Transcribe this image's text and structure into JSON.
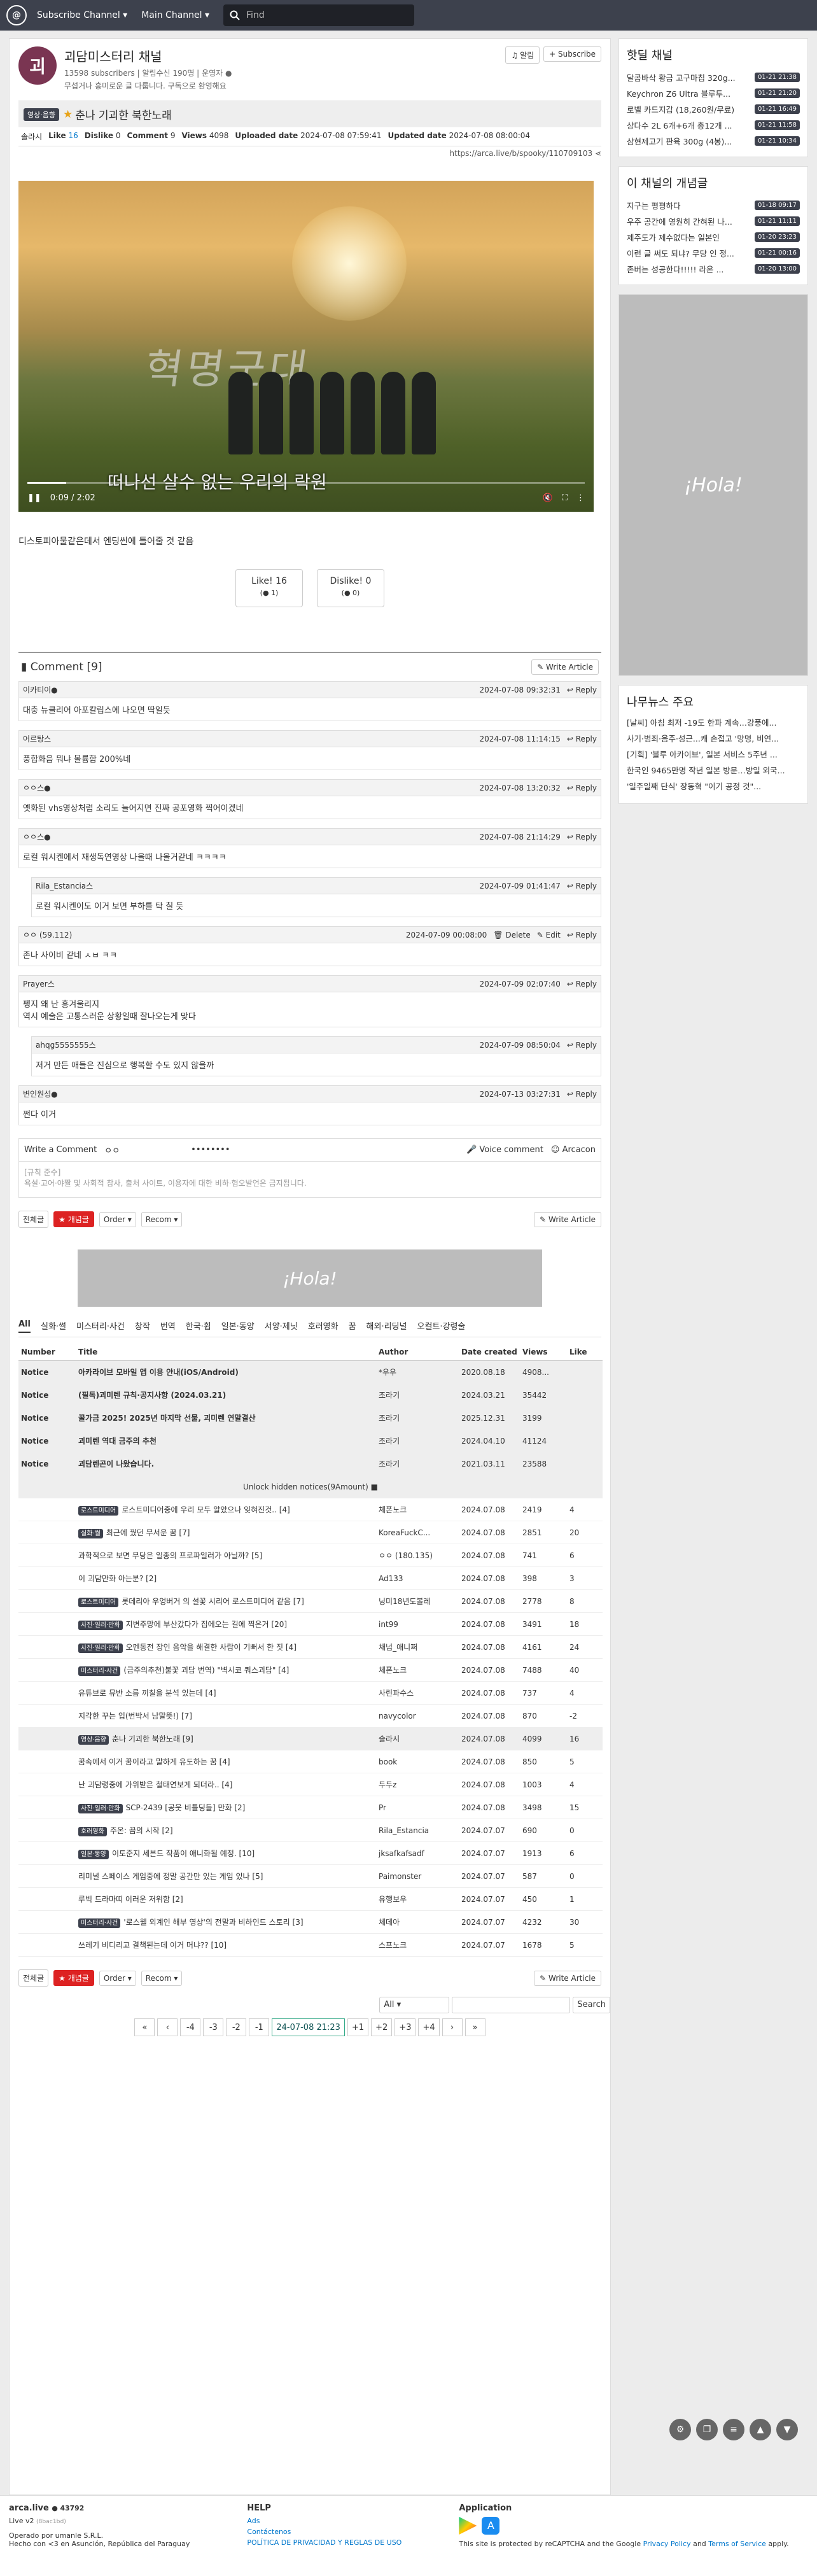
{
  "nav": {
    "subscribe": "Subscribe Channel ▾",
    "main": "Main Channel ▾",
    "search_placeholder": "Find"
  },
  "channel": {
    "icon": "괴",
    "title": "괴담미스터리 채널",
    "subs": "13598 subscribers | 알림수신 190명 | 운영자 ●",
    "desc": "무섭거나 흥미로운 글 다룹니다. 구독으로 환영해요",
    "alarm": "알림",
    "subscribe": "+ Subscribe"
  },
  "article": {
    "category": "영상·음향",
    "title": "춘나 기괴한 북한노래",
    "author": "솔라시",
    "like_l": "Like",
    "like": "16",
    "dislike_l": "Dislike",
    "dislike": "0",
    "comment_l": "Comment",
    "comment": "9",
    "views_l": "Views",
    "views": "4098",
    "up_l": "Uploaded date",
    "uploaded": "2024-07-08 07:59:41",
    "upd_l": "Updated date",
    "updated": "2024-07-08 08:00:04",
    "url": "https://arca.live/b/spooky/110709103",
    "video_text": "혁명군대",
    "video_sub": "떠나선 살수 없는 우리의 락원",
    "time": "0:09 / 2:02",
    "progress": 0.07,
    "desc": "디스토피아물같은데서 엔딩씬에 틀어줄 것 같음",
    "like_btn": "Like! 16",
    "like_sub": "(● 1)",
    "dislike_btn": "Dislike! 0",
    "dislike_sub": "(● 0)"
  },
  "comments_head": "Comment [9]",
  "write_article": "✎ Write Article",
  "reply": "↩ Reply",
  "comments": [
    {
      "user": "이카티이●",
      "date": "2024-07-08 09:32:31",
      "text": "대충 뉴클리어 아포칼립스에 나오면 딱일듯",
      "reply": false
    },
    {
      "user": "어르탕스",
      "date": "2024-07-08 11:14:15",
      "text": "풍합화음 뭐냐 볼륨함 200%네",
      "reply": false
    },
    {
      "user": "ㅇㅇ스●",
      "date": "2024-07-08 13:20:32",
      "text": "옛화된 vhs영상처럼 소리도 늘어지면 진짜 공포영화 찍어이겠네",
      "reply": false
    },
    {
      "user": "ㅇㅇ스●",
      "date": "2024-07-08 21:14:29",
      "text": "로컬 워시켄에서 재생독연영상 나올때 나올거같네 ㅋㅋㅋㅋ",
      "reply": false
    },
    {
      "user": "Rila_Estancia스",
      "date": "2024-07-09 01:41:47",
      "text": "로컬 워시켄이도 이거 보면 부하를 탁 칠 듯",
      "reply": true
    },
    {
      "user": "ㅇㅇ (59.112)",
      "date": "2024-07-09 00:08:00",
      "text": "존나 사이비 같네 ㅅㅂ ㅋㅋ",
      "reply": false,
      "own": true
    },
    {
      "user": "Prayer스",
      "date": "2024-07-09 02:07:40",
      "text": "펭지 왜 난 흥겨울리지\n역시 예술은 고통스러운 상황일때 잘나오는게 맞다",
      "reply": false
    },
    {
      "user": "ahqg5555555스",
      "date": "2024-07-09 08:50:04",
      "text": "저거 만든 애들은 진심으로 행복할 수도 있지 않을까",
      "reply": true
    },
    {
      "user": "변인원성●",
      "date": "2024-07-13 03:27:31",
      "text": "쩐다 이거",
      "reply": false
    }
  ],
  "own_actions": {
    "delete": "🗑 Delete",
    "edit": "✎ Edit"
  },
  "write": {
    "label": "Write a Comment",
    "user": "ㅇㅇ",
    "pw": "••••••••",
    "voice": "Voice comment",
    "arcacon": "Arcacon",
    "rule1": "[규칙 준수]",
    "rule2": "욕설·고어·야짤 및 사회적 참사, 출처 사이트, 이용자에 대한 비하·험오발언은 금지됩니다."
  },
  "listbar": {
    "all": "전체글",
    "hot": "★ 개념글",
    "order": "Order ▾",
    "recom": "Recom ▾"
  },
  "cats": [
    "All",
    "실화·썰",
    "미스터리·사건",
    "창작",
    "번역",
    "한국·휩",
    "일본·동양",
    "서양·제닛",
    "호러영화",
    "꿈",
    "해외·리딩널",
    "오컬트·강령술"
  ],
  "cols": [
    "Number",
    "Title",
    "Author",
    "Date created",
    "Views",
    "Like"
  ],
  "notices": [
    {
      "t": "아카라이브 모바일 앱 이용 안내(iOS/Android)",
      "a": "*우우",
      "d": "2020.08.18",
      "v": "4908..."
    },
    {
      "t": "(필독)괴미렌 규칙·공지사항 (2024.03.21)",
      "a": "조라기",
      "d": "2024.03.21",
      "v": "35442"
    },
    {
      "t": "꿀가금 2025! 2025년 마지막 선물, 괴미렌 연말결산",
      "a": "조라기",
      "d": "2025.12.31",
      "v": "3199"
    },
    {
      "t": "괴미렌 역대 금주의 추천",
      "a": "조라기",
      "d": "2024.04.10",
      "v": "41124"
    },
    {
      "t": "괴담렌곤이 나왔습니다.",
      "a": "조라기",
      "d": "2021.03.11",
      "v": "23588"
    }
  ],
  "unlock": "Unlock hidden notices(9Amount) ■",
  "rows": [
    {
      "c": "로스트미디어",
      "t": "로스트미디어중에 우리 모두 알았으나 잊혀진것.. [4]",
      "a": "체폰노크",
      "d": "2024.07.08",
      "v": "2419",
      "l": "4"
    },
    {
      "c": "실화·썰",
      "t": "최근에 꿨던 무서운 꿈 [7]",
      "a": "KoreaFuckC...",
      "d": "2024.07.08",
      "v": "2851",
      "l": "20"
    },
    {
      "c": "",
      "t": "과학적으로 보면 무당은 일종의 프로파일러가 아닐까? [5]",
      "a": "ㅇㅇ (180.135)",
      "d": "2024.07.08",
      "v": "741",
      "l": "6"
    },
    {
      "c": "",
      "t": "이 괴담만화 아는분? [2]",
      "a": "Ad133",
      "d": "2024.07.08",
      "v": "398",
      "l": "3"
    },
    {
      "c": "로스트미디어",
      "t": "롯데리아 우엉버거 의 설꽃 시리어 로스트미디어 같음 [7]",
      "a": "닝미18년도볼레",
      "d": "2024.07.08",
      "v": "2778",
      "l": "8"
    },
    {
      "c": "사진·일러·만화",
      "t": "지변주망에 부산갔다가 집에오는 길에 찍은거 [20]",
      "a": "int99",
      "d": "2024.07.08",
      "v": "3491",
      "l": "18"
    },
    {
      "c": "사진·일러·만화",
      "t": "오멘동전 장인 음악을 해결한 사람이 기뻐서 한 짓 [4]",
      "a": "채넘_애니쩌",
      "d": "2024.07.08",
      "v": "4161",
      "l": "24"
    },
    {
      "c": "미스터리·사건",
      "t": "(금주의추천)불꽃 괴담 번역) \"벽시코 쿼스괴담\" [4]",
      "a": "체폰노크",
      "d": "2024.07.08",
      "v": "7488",
      "l": "40"
    },
    {
      "c": "",
      "t": "유튜브로 뮤반 소름 끼칠을 분석 있는데 [4]",
      "a": "사린파수스",
      "d": "2024.07.08",
      "v": "737",
      "l": "4"
    },
    {
      "c": "",
      "t": "지각한 꾸는 입(번박서 남말뜻!) [7]",
      "a": "navycolor",
      "d": "2024.07.08",
      "v": "870",
      "l": "-2"
    },
    {
      "c": "영상·음향",
      "t": "춘나 기괴한 북한노래 [9]",
      "a": "솔라시",
      "d": "2024.07.08",
      "v": "4099",
      "l": "16",
      "cur": true
    },
    {
      "c": "",
      "t": "꿈속에서 이거 꿈이라고 말하게 유도하는 꿈 [4]",
      "a": "book",
      "d": "2024.07.08",
      "v": "850",
      "l": "5"
    },
    {
      "c": "",
      "t": "난 괴담령중에 가위받은 철태연보게 되더라.. [4]",
      "a": "두두z",
      "d": "2024.07.08",
      "v": "1003",
      "l": "4"
    },
    {
      "c": "사진·일러·만화",
      "t": "SCP-2439 [공웃 비틀딩들] 만화 [2]",
      "a": "Pr",
      "d": "2024.07.08",
      "v": "3498",
      "l": "15"
    },
    {
      "c": "호러영화",
      "t": "주온: 끔의 시작 [2]",
      "a": "Rila_Estancia",
      "d": "2024.07.07",
      "v": "690",
      "l": "0"
    },
    {
      "c": "일본·동양",
      "t": "이토준지 세븐드 작품이 애니화될 예정. [10]",
      "a": "jksafkafsadf",
      "d": "2024.07.07",
      "v": "1913",
      "l": "6"
    },
    {
      "c": "",
      "t": "리미널 스페이스 게임중에 정말 공간만 있는 게임 있나 [5]",
      "a": "Paimonster",
      "d": "2024.07.07",
      "v": "587",
      "l": "0"
    },
    {
      "c": "",
      "t": "루빅 드라마띠 이러운 저위함 [2]",
      "a": "유행보우",
      "d": "2024.07.07",
      "v": "450",
      "l": "1"
    },
    {
      "c": "미스터리·사건",
      "t": "'로스웰 외계인 해부 영상'의 전말과 비하인드 스토리 [3]",
      "a": "체데아",
      "d": "2024.07.07",
      "v": "4232",
      "l": "30"
    },
    {
      "c": "",
      "t": "쓰레기 비디리고 결책된는데 이거 머냐?? [10]",
      "a": "스프노크",
      "d": "2024.07.07",
      "v": "1678",
      "l": "5"
    }
  ],
  "search": {
    "scope": "All ▾",
    "button": "Search"
  },
  "pages": [
    "«",
    "‹",
    "-4",
    "-3",
    "-2",
    "-1",
    "24-07-08 21:23",
    "+1",
    "+2",
    "+3",
    "+4",
    "›",
    "»"
  ],
  "side": {
    "hot_title": "핫딜 채널",
    "hot": [
      [
        "달콤바삭 황금 고구마칩 320g...",
        "01-21 21:38"
      ],
      [
        "Keychron Z6 Ultra 블루투...",
        "01-21 21:20"
      ],
      [
        "로벨 카드지갑 (18,260원/무료)",
        "01-21 16:49"
      ],
      [
        "상다수 2L 6개+6개 총12개 ...",
        "01-21 11:58"
      ],
      [
        "삼현제고기 판육 300g (4봉)...",
        "01-21 10:34"
      ]
    ],
    "best_title": "이 채널의 개념글",
    "best": [
      [
        "지구는 평평하다",
        "01-18 09:17"
      ],
      [
        "우주 공간에 영원히 간혀된 나...",
        "01-21 11:11"
      ],
      [
        "제주도가 제수없다는 일본인",
        "01-20 23:23"
      ],
      [
        "이런 글 써도 되냐? 무당 인 정...",
        "01-21 00:16"
      ],
      [
        "존버는 성공한다!!!!! 라온 ...",
        "01-20 13:00"
      ]
    ],
    "ad_text": "¡Hola!",
    "news_title": "나무뉴스 주요",
    "news": [
      "[날씨] 아침 최저 -19도 한파 계속…강풍에...",
      "사기·범죄·음주·성근...캐 손접고 '망명, 비연...",
      "[기획] '블루 아카이브', 일본 서비스 5주년 ...",
      "한국인 9465만명 작년 일본 방문…방일 외국...",
      "'일주일째 단식' 장동혁 \"이기 공정 것\"..."
    ]
  },
  "banner_text": "¡Hola!",
  "footer": {
    "brand": "arca.live",
    "users": "● 43792",
    "ver": "Live v2",
    "ver2": "(8bac1bd)",
    "op": "Operado por umanle S.R.L.",
    "made": "Hecho con <3 en Asunción, República del Paraguay",
    "help": "HELP",
    "ads": "Ads",
    "contact": "Contáctenos",
    "policy": "POLÍTICA DE PRIVACIDAD Y REGLAS DE USO",
    "app": "Application",
    "recaptcha": "This site is protected by reCAPTCHA and the Google",
    "privacy": "Privacy Policy",
    "and": "and",
    "terms": "Terms of Service",
    "apply": "apply."
  }
}
